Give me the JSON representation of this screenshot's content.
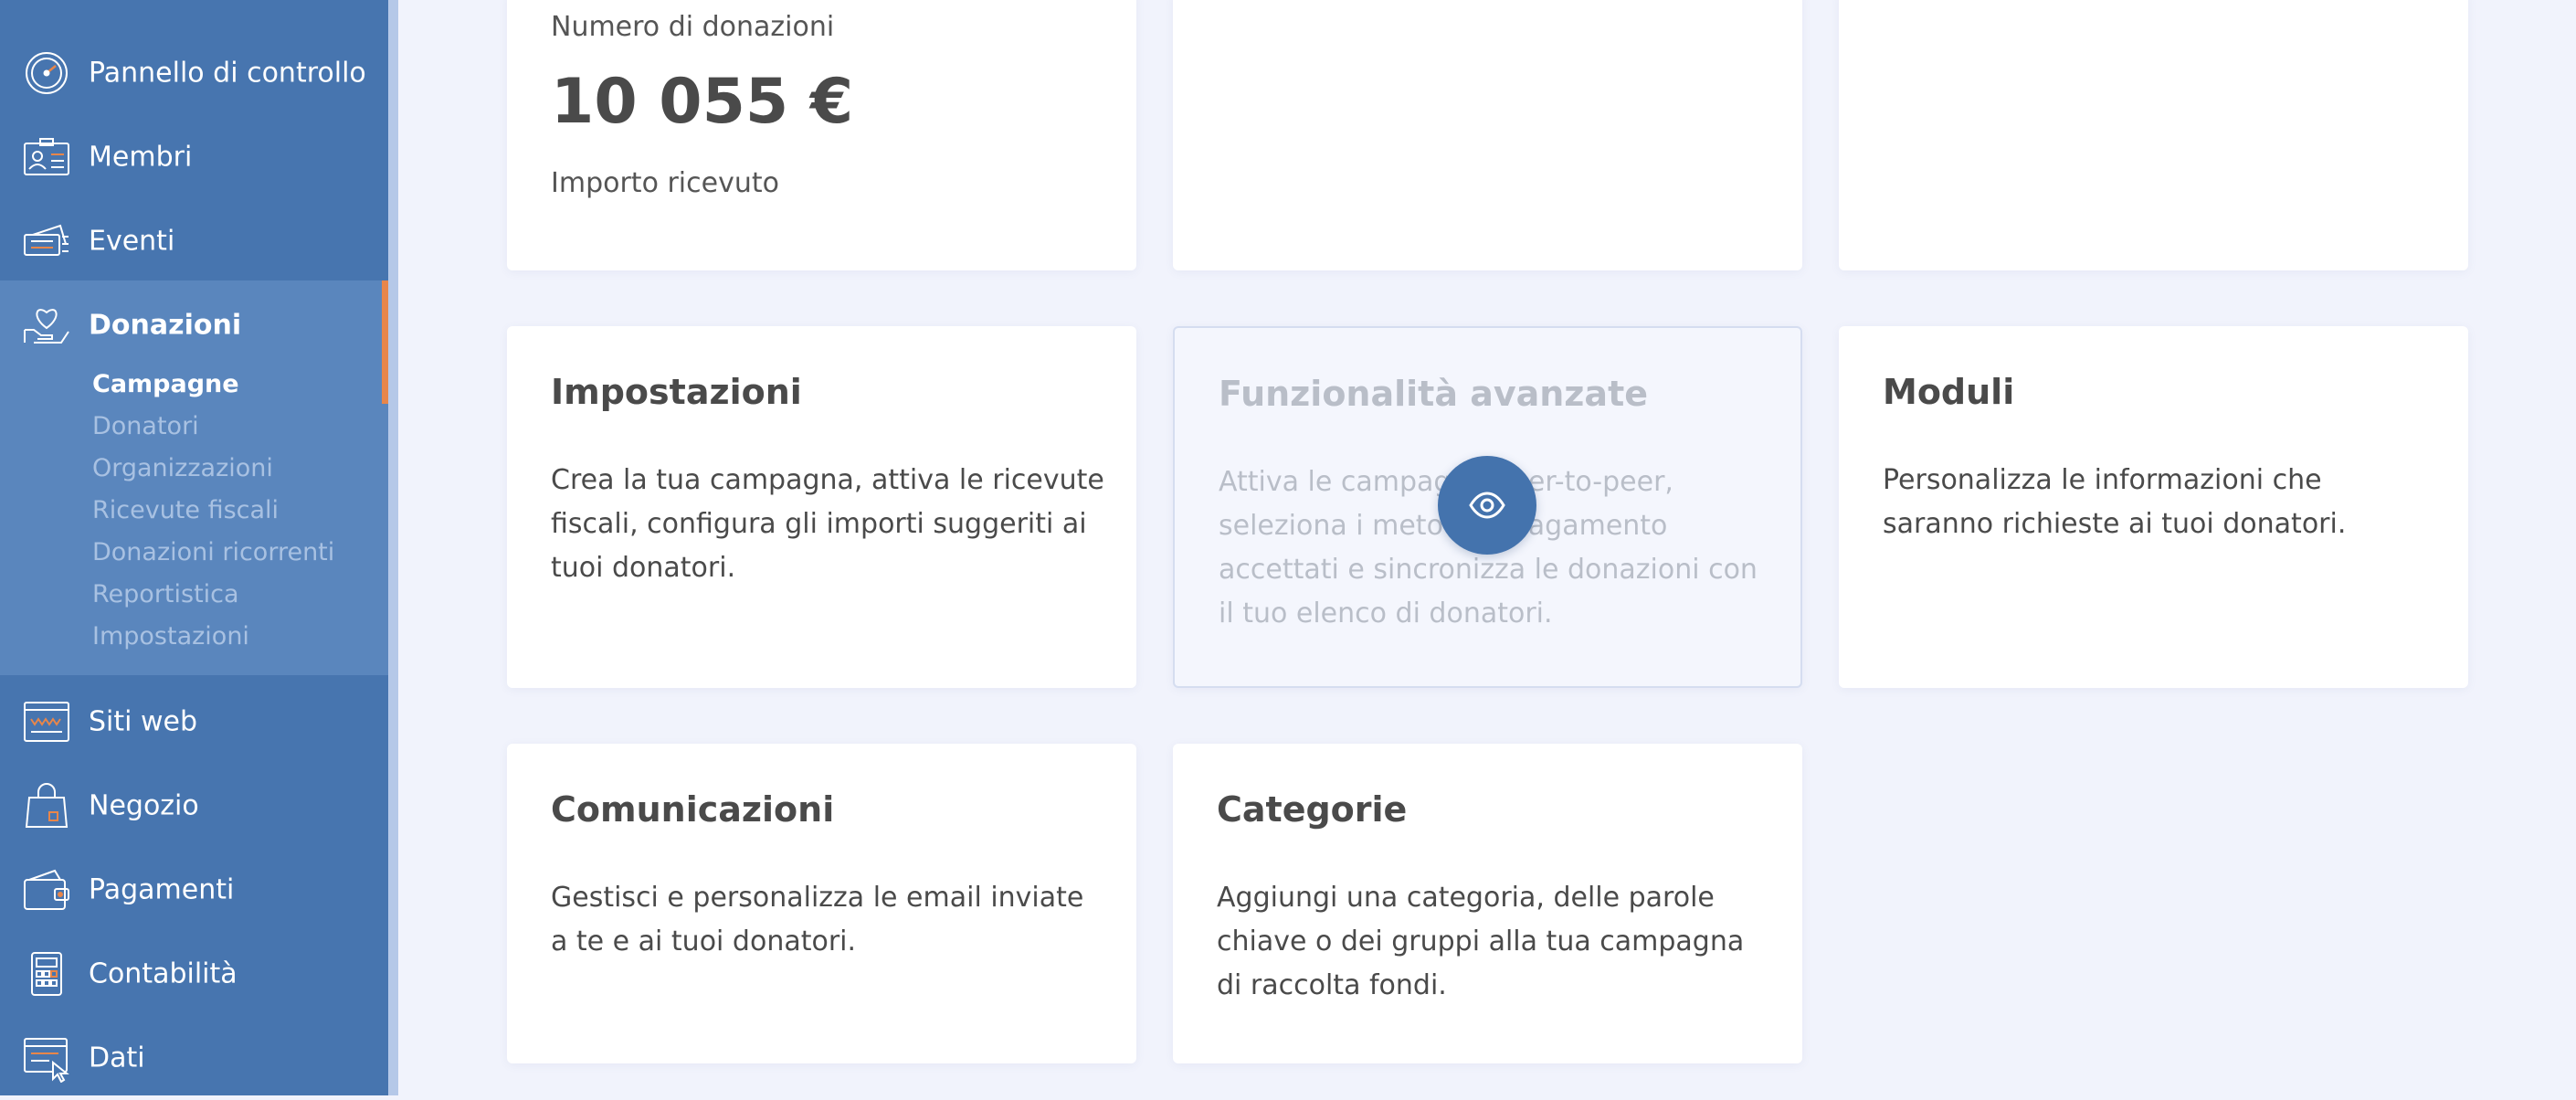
{
  "sidebar": {
    "items": [
      {
        "label": "Pannello di controllo",
        "icon": "speedometer-icon"
      },
      {
        "label": "Membri",
        "icon": "member-card-icon"
      },
      {
        "label": "Eventi",
        "icon": "tickets-icon"
      },
      {
        "label": "Donazioni",
        "icon": "heart-hand-icon"
      },
      {
        "label": "Siti web",
        "icon": "browser-window-icon"
      },
      {
        "label": "Negozio",
        "icon": "shopping-bag-icon"
      },
      {
        "label": "Pagamenti",
        "icon": "wallet-icon"
      },
      {
        "label": "Contabilità",
        "icon": "calculator-icon"
      },
      {
        "label": "Dati",
        "icon": "data-icon"
      }
    ],
    "donazioni_subitems": [
      "Campagne",
      "Donatori",
      "Organizzazioni",
      "Ricevute fiscali",
      "Donazioni ricorrenti",
      "Reportistica",
      "Impostazioni"
    ],
    "active_subitem": "Campagne"
  },
  "stats": {
    "label_top": "Numero di donazioni",
    "value": "10 055 €",
    "label_bottom": "Importo ricevuto"
  },
  "cards": [
    {
      "title": "Impostazioni",
      "description": "Crea la tua campagna, attiva le ricevute fiscali, configura gli importi suggeriti ai tuoi donatori."
    },
    {
      "title": "Funzionalità avanzate",
      "description": "Attiva le campagne peer-to-peer, seleziona i metodi di pagamento accettati e sincronizza le donazioni con il tuo elenco di donatori."
    },
    {
      "title": "Moduli",
      "description": "Personalizza le informazioni che saranno richieste ai tuoi donatori."
    },
    {
      "title": "Comunicazioni",
      "description": "Gestisci e personalizza le email inviate a te e ai tuoi donatori."
    },
    {
      "title": "Categorie",
      "description": "Aggiungi una categoria, delle parole chiave o dei gruppi alla tua campagna di raccolta fondi."
    }
  ],
  "colors": {
    "sidebar": "#4775af",
    "sidebar_active_group": "#5a86bd",
    "accent": "#e8864a",
    "eye_button": "#4473ad",
    "page_background": "#f1f3fc"
  }
}
